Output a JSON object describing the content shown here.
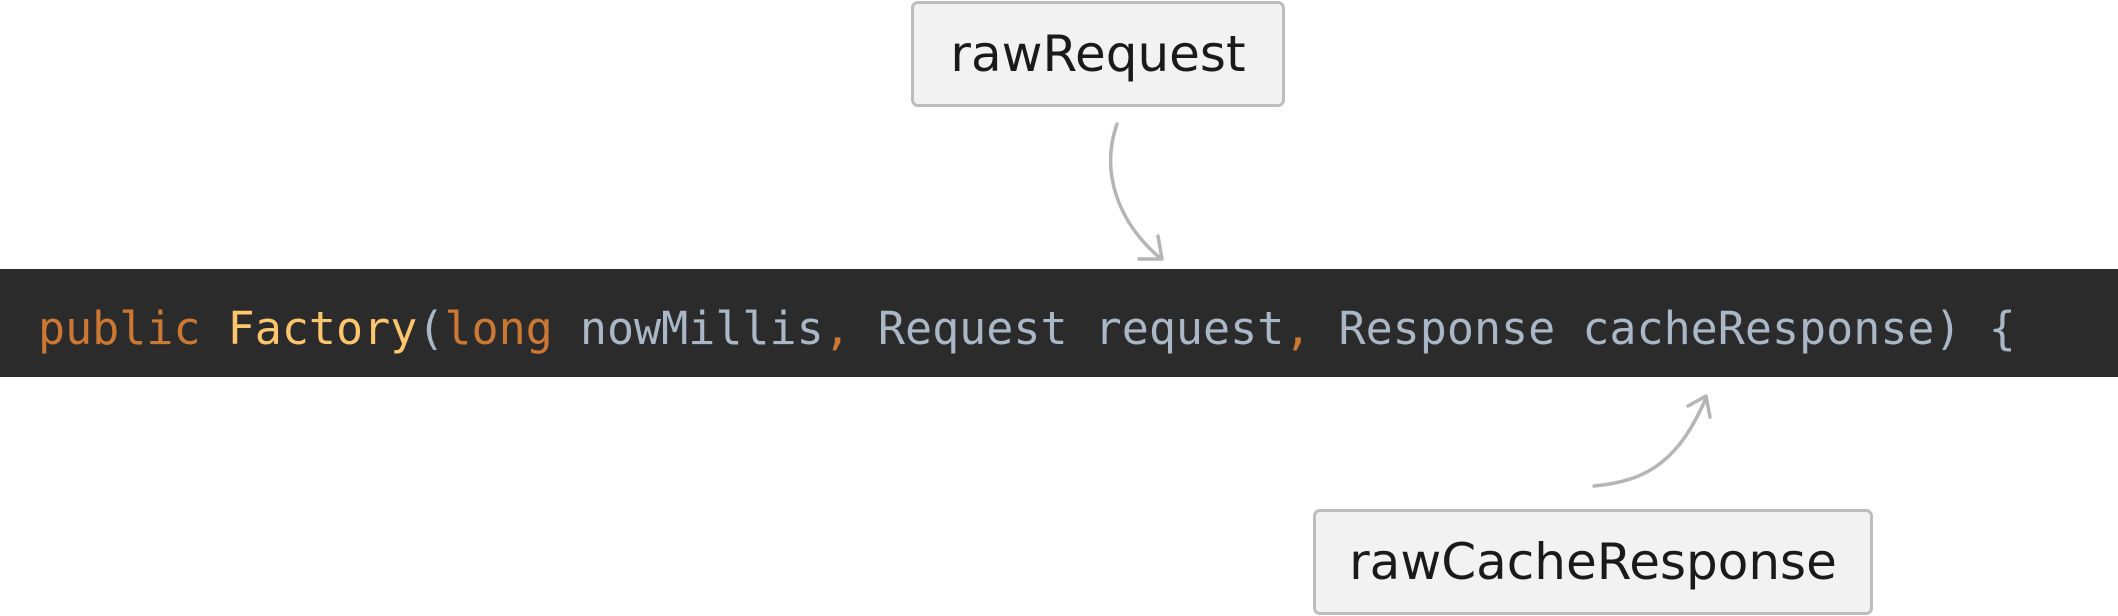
{
  "labels": {
    "top": "rawRequest",
    "bottom": "rawCacheResponse"
  },
  "code": {
    "tokens": [
      {
        "text": "public",
        "kind": "keyword"
      },
      {
        "text": " ",
        "kind": "plain"
      },
      {
        "text": "Factory",
        "kind": "function"
      },
      {
        "text": "(",
        "kind": "plain"
      },
      {
        "text": "long",
        "kind": "keyword"
      },
      {
        "text": " nowMillis",
        "kind": "plain"
      },
      {
        "text": ",",
        "kind": "keyword"
      },
      {
        "text": " Request request",
        "kind": "plain"
      },
      {
        "text": ",",
        "kind": "keyword"
      },
      {
        "text": " Response cacheResponse) {",
        "kind": "plain"
      }
    ]
  },
  "colors": {
    "keyword": "#cc7832",
    "function": "#ffc66d",
    "plain": "#a9b7c6",
    "code_background": "#2b2b2b",
    "label_background": "#f2f2f2",
    "label_border": "#bdbdbd",
    "arrow": "#b5b5b5"
  }
}
